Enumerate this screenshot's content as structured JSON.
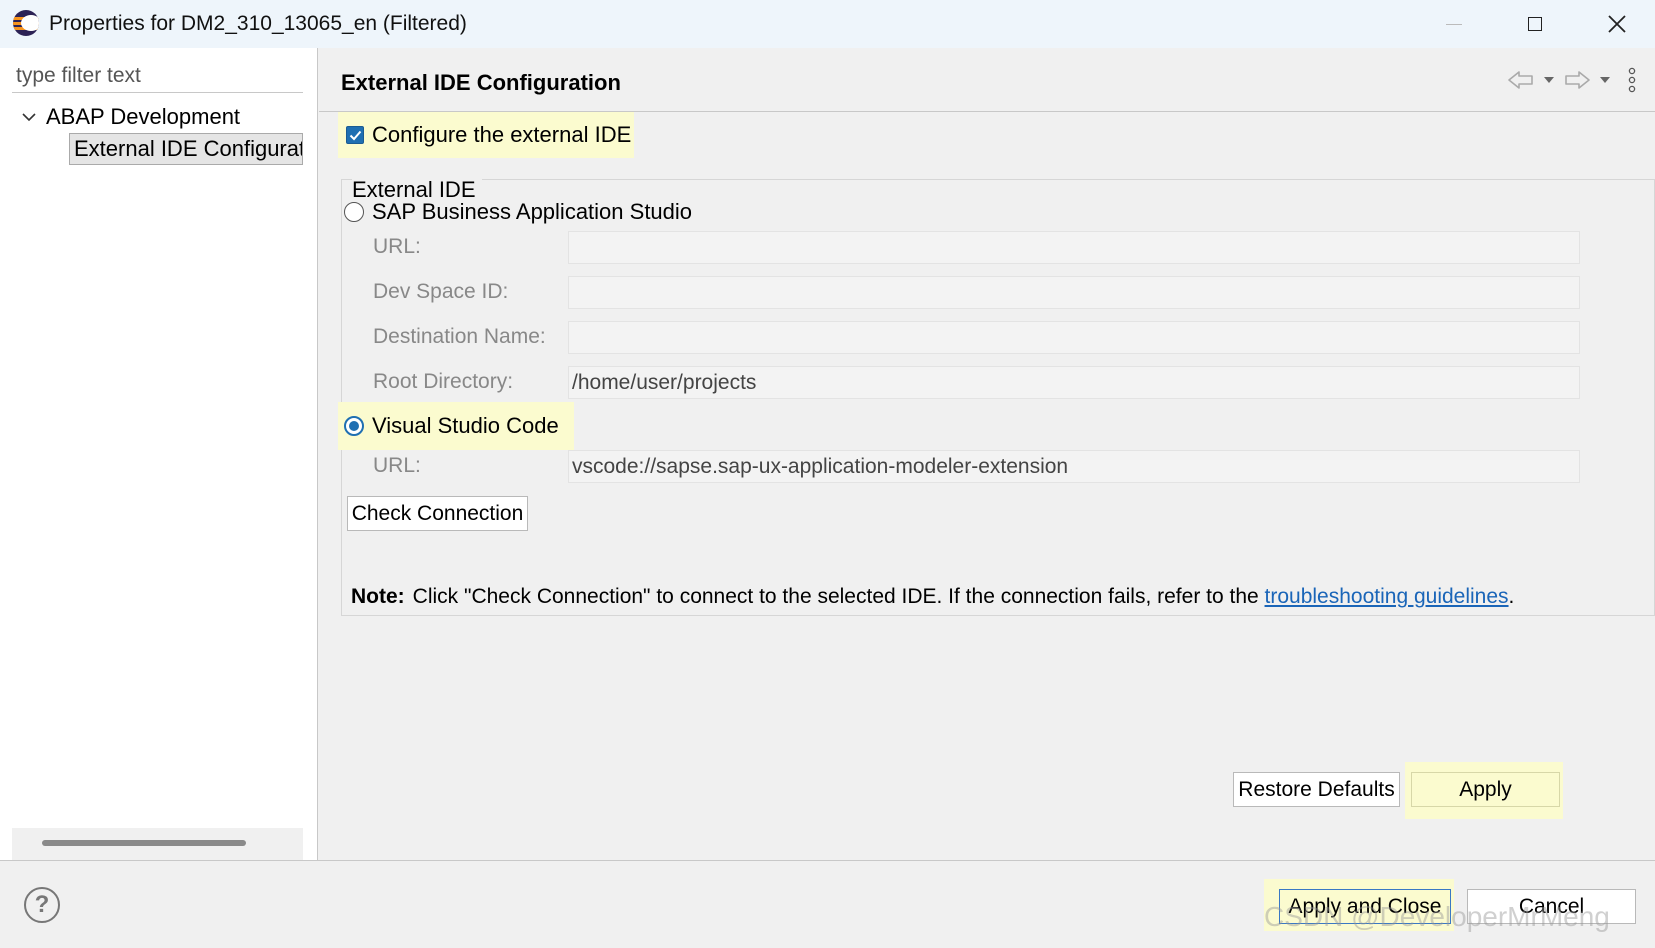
{
  "window": {
    "title": "Properties for DM2_310_13065_en (Filtered)"
  },
  "sidebar": {
    "filter_placeholder": "type filter text",
    "tree": {
      "root_label": "ABAP Development",
      "child_label": "External IDE Configuration"
    }
  },
  "page": {
    "title": "External IDE Configuration",
    "configure_checkbox": {
      "label": "Configure the external IDE",
      "checked": true
    },
    "group_label": "External IDE",
    "options": [
      {
        "label": "SAP Business Application Studio",
        "selected": false,
        "fields": [
          {
            "label": "URL:",
            "value": ""
          },
          {
            "label": "Dev Space ID:",
            "value": ""
          },
          {
            "label": "Destination Name:",
            "value": ""
          },
          {
            "label": "Root Directory:",
            "value": "/home/user/projects"
          }
        ]
      },
      {
        "label": "Visual Studio Code",
        "selected": true,
        "fields": [
          {
            "label": "URL:",
            "value": "vscode://sapse.sap-ux-application-modeler-extension"
          }
        ]
      }
    ],
    "check_connection_label": "Check Connection",
    "note": {
      "prefix": "Note:",
      "text": "Click \"Check Connection\" to connect to the selected IDE. If the connection fails, refer to the ",
      "link": "troubleshooting guidelines",
      "suffix": "."
    },
    "restore_defaults_label": "Restore Defaults",
    "apply_label": "Apply"
  },
  "footer": {
    "apply_close_label": "Apply and Close",
    "cancel_label": "Cancel",
    "watermark": "CSDN @DeveloperMrMeng"
  },
  "icons": {
    "app": "eclipse-icon",
    "help": "help-icon",
    "back": "back-arrow-icon",
    "forward": "forward-arrow-icon",
    "menu": "view-menu-icon"
  },
  "colors": {
    "accent": "#1f6fb2",
    "highlight": "#fbfbcf",
    "link": "#1a65b8"
  }
}
